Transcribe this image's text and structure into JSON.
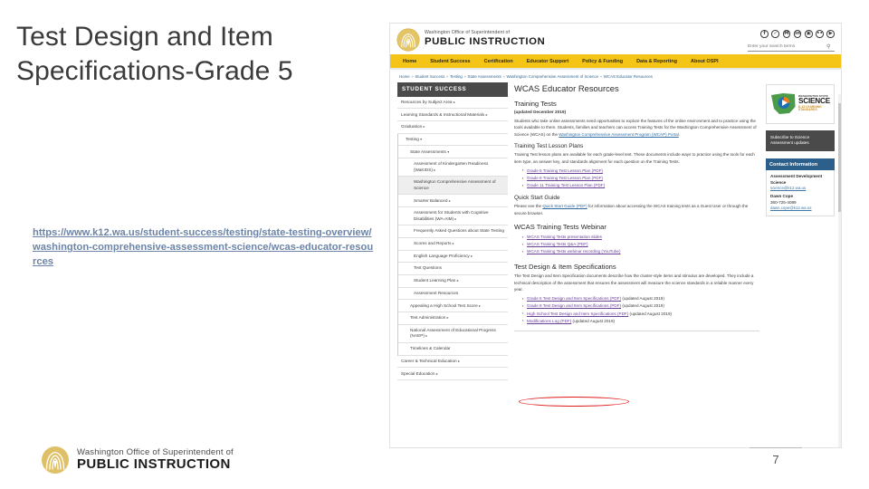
{
  "slide": {
    "title": "Test Design and Item Specifications-Grade 5",
    "url": "https://www.k12.wa.us/student-success/testing/state-testing-overview/washington-comprehensive-assessment-science/wcas-educator-resources",
    "page_number": "7",
    "footer_logo": {
      "line1": "Washington Office of Superintendent of",
      "line2": "PUBLIC INSTRUCTION",
      "icon": "ospi-seal-icon",
      "color": "#d4b249"
    }
  },
  "screenshot": {
    "header": {
      "logo_icon": "ospi-seal-icon",
      "brand_line1": "Washington Office of Superintendent of",
      "brand_line2": "PUBLIC INSTRUCTION",
      "social": [
        {
          "name": "facebook-icon",
          "glyph": "f"
        },
        {
          "name": "twitter-icon",
          "glyph": "✓"
        },
        {
          "name": "medium-icon",
          "glyph": "M"
        },
        {
          "name": "linkedin-icon",
          "glyph": "in"
        },
        {
          "name": "instagram-icon",
          "glyph": "▣"
        },
        {
          "name": "flickr-icon",
          "glyph": "••"
        },
        {
          "name": "youtube-icon",
          "glyph": "▶"
        }
      ],
      "search_placeholder": "Enter your search terms",
      "search_value": "",
      "search_icon": "magnifier-icon"
    },
    "nav": {
      "accent": "#f4c417",
      "items": [
        "Home",
        "Student Success",
        "Certification",
        "Educator Support",
        "Policy & Funding",
        "Data & Reporting",
        "About OSPI"
      ]
    },
    "breadcrumb": [
      "Home",
      "Student Success",
      "Testing",
      "State Assessments",
      "Washington Comprehensive Assessment of Science",
      "WCAS Educator Resources"
    ],
    "left_nav": {
      "heading": "STUDENT SUCCESS",
      "items": [
        {
          "label": "Resources by Subject Area",
          "caret": true,
          "level": 0,
          "active": false
        },
        {
          "label": "Learning Standards & Instructional Materials",
          "caret": true,
          "level": 0,
          "active": false
        },
        {
          "label": "Graduation",
          "caret": true,
          "level": 0,
          "active": false
        },
        {
          "label": "Testing",
          "caret": true,
          "level": 0,
          "active": false,
          "open": true
        },
        {
          "label": "State Assessments",
          "caret": true,
          "level": 1,
          "active": false,
          "open": true
        },
        {
          "label": "Assessment of Kindergarten Readiness (WaKIDS)",
          "caret": true,
          "level": 2,
          "active": false
        },
        {
          "label": "Washington Comprehensive Assessment of Science",
          "caret": false,
          "level": 2,
          "active": true
        },
        {
          "label": "Smarter Balanced",
          "caret": true,
          "level": 2,
          "active": false
        },
        {
          "label": "Assessment for Students with Cognitive Disabilities (WA-AIM)",
          "caret": true,
          "level": 2,
          "active": false
        },
        {
          "label": "Frequently Asked Questions about State Testing",
          "caret": false,
          "level": 2,
          "active": false
        },
        {
          "label": "Scores and Reports",
          "caret": true,
          "level": 2,
          "active": false
        },
        {
          "label": "English Language Proficiency",
          "caret": true,
          "level": 2,
          "active": false
        },
        {
          "label": "Test Questions",
          "caret": false,
          "level": 2,
          "active": false
        },
        {
          "label": "Student Learning Plan",
          "caret": true,
          "level": 2,
          "active": false
        },
        {
          "label": "Assessment Resources",
          "caret": false,
          "level": 2,
          "active": false
        },
        {
          "label": "Appealing a High School Test Score",
          "caret": true,
          "level": 1,
          "active": false
        },
        {
          "label": "Test Administration",
          "caret": true,
          "level": 1,
          "active": false
        },
        {
          "label": "National Assessment of Educational Progress (NAEP)",
          "caret": true,
          "level": 1,
          "active": false
        },
        {
          "label": "Timelines & Calendar",
          "caret": false,
          "level": 1,
          "active": false
        },
        {
          "label": "Career & Technical Education",
          "caret": true,
          "level": 0,
          "active": false
        },
        {
          "label": "Special Education",
          "caret": true,
          "level": 0,
          "active": false
        }
      ]
    },
    "main": {
      "page_title": "WCAS Educator Resources",
      "sections": [
        {
          "heading": "Training Tests",
          "updated": "(updated December 2019)",
          "paragraph_pre": "Students who take online assessments need opportunities to explore the features of the online environment and to practice using the tools available to them. Students, families and teachers can access Training Tests for the Washington Comprehensive Assessment of Science (WCAS) on the ",
          "paragraph_link": "Washington Comprehensive Assessment Program (WCAP) Portal",
          "paragraph_post": "."
        },
        {
          "heading": "Training Test Lesson Plans",
          "paragraph": "Training Test lesson plans are available for each grade-level test. These documents include ways to practice using the tools for each item type, an answer key, and standards alignment for each question on the Training Tests.",
          "links": [
            "Grade 5 Training Test Lesson Plan (PDF)",
            "Grade 8 Training Test Lesson Plan (PDF)",
            "Grade 11 Training Test Lesson Plan (PDF)"
          ]
        },
        {
          "heading": "Quick Start Guide",
          "paragraph_pre": "Please see the ",
          "paragraph_link": "Quick Start Guide (PDF)",
          "paragraph_post": " for information about accessing the WCAS training tests as a Guest User or through the secure browser."
        },
        {
          "heading": "WCAS Training Tests Webinar",
          "links": [
            "WCAS Training Tests presentation slides",
            "WCAS Training Tests Q&A (PDF)",
            "WCAS Training Tests webinar recording (YouTube)"
          ]
        },
        {
          "heading": "Test Design & Item Specifications",
          "paragraph": "The Test Design and Item Specification documents describe how the cluster-style items and stimulus are developed. They include a technical description of the assessment that ensures the assessment will measure the science standards in a reliable manner every year.",
          "link_rows": [
            {
              "link": "Grade 5 Test Design and Item Specifications (PDF)",
              "suffix": " (updated August 2019)",
              "highlighted": true
            },
            {
              "link": "Grade 8 Test Design and Item Specifications (PDF)",
              "suffix": " (updated August 2019)",
              "highlighted": false
            },
            {
              "link": "High School Test Design and Item Specifications (PDF)",
              "suffix": " (updated August 2019)",
              "highlighted": false
            },
            {
              "link": "Modifications Log (PDF)",
              "suffix": " (updated August 2019)",
              "highlighted": false
            }
          ]
        }
      ]
    },
    "right_rail": {
      "badge": {
        "icon": "washington-state-map-icon",
        "line1": "WASHINGTON STATE",
        "line2": "SCIENCE",
        "line3": "K-12 LEARNING STANDARDS"
      },
      "subscribe_label": "Subscribe to Science Assessment updates",
      "contact_heading": "Contact Information",
      "contact_name": "Assessment Development Science",
      "contact_email": "science@k12.wa.us",
      "contact_person": "Dawn Cope",
      "contact_phone": "360-725-4089",
      "contact_person_email": "dawn.cope@k12.wa.us",
      "header_color": "#2c5f8a"
    },
    "annotation": {
      "shape": "red-ellipse",
      "color": "#e01b1b",
      "target": "Grade 5 Test Design and Item Specifications (PDF)"
    }
  }
}
